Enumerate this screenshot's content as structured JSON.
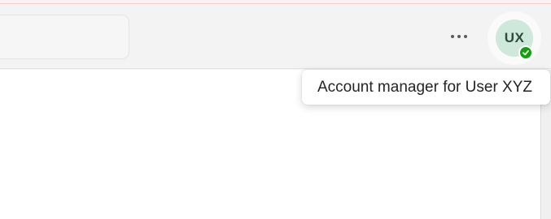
{
  "header": {
    "more_options": {
      "icon": "more-horizontal-icon"
    },
    "account": {
      "initials": "UX",
      "avatar_color": "#cfe8dc",
      "presence": {
        "status": "available",
        "color": "#13a10e",
        "icon": "checkmark-icon"
      }
    }
  },
  "tooltip": {
    "text": "Account manager for User XYZ"
  }
}
